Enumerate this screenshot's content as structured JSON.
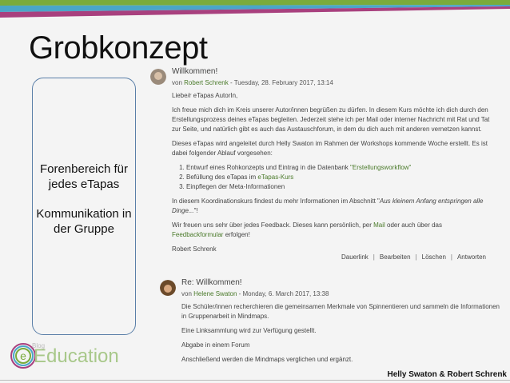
{
  "slide": {
    "title": "Grobkonzept",
    "box_lines": [
      "Forenbereich für jedes eTapas",
      "Kommunikation in der Gruppe"
    ],
    "footer": "Helly Swaton & Robert Schrenk"
  },
  "logo": {
    "small": "Blog",
    "text": "Education"
  },
  "colors": {
    "green": "#7aab3c",
    "blue": "#4aa6c8",
    "purple": "#a8407e"
  },
  "post1": {
    "title": "Willkommen!",
    "by": "von",
    "author": "Robert Schrenk",
    "date": " - Tuesday, 28. February 2017, 13:14",
    "greeting": "Liebe/r eTapas AutorIn,",
    "p1": "Ich freue mich dich im Kreis unserer Autor/innen begrüßen zu dürfen. In diesem Kurs möchte ich dich durch den Erstellungsprozess deines eTapas begleiten. Jederzeit stehe ich per Mail oder interner Nachricht mit Rat und Tat zur Seite, und natürlich gibt es auch das Austauschforum, in dem du dich auch mit anderen vernetzen kannst.",
    "p2": "Dieses eTapas wird angeleitet durch Helly Swaton im Rahmen der Workshops kommende Woche erstellt. Es ist dabei folgender Ablauf vorgesehen:",
    "steps": [
      {
        "text": "Entwurf eines Rohkonzepts und Eintrag in die Datenbank ",
        "link": "\"Erstellungsworkflow\""
      },
      {
        "text": "Befüllung des eTapas im ",
        "link": "eTapas-Kurs"
      },
      {
        "text": "Einpflegen der Meta-Informationen",
        "link": ""
      }
    ],
    "p3_pre": "In diesem Koordinationskurs findest du mehr Informationen im Abschnitt \"",
    "p3_em": "Aus kleinem Anfang entspringen alle Dinge...",
    "p3_post": "\"!",
    "p4_pre": "Wir freuen uns sehr über jedes Feedback. Dieses kann persönlich, per ",
    "p4_mail": "Mail",
    "p4_mid": " oder auch über das ",
    "p4_form": "Feedbackformular",
    "p4_post": " erfolgen!",
    "signature": "Robert Schrenk",
    "actions": [
      "Dauerlink",
      "Bearbeiten",
      "Löschen",
      "Antworten"
    ]
  },
  "post2": {
    "title": "Re: Willkommen!",
    "by": "von",
    "author": "Helene Swaton",
    "date": " - Monday, 6. March 2017, 13:38",
    "paragraphs": [
      "Die Schüler/innen recherchieren die gemeinsamen Merkmale von Spinnentieren und sammeln die Informationen in Gruppenarbeit in Mindmaps.",
      "Eine Linksammlung wird zur Verfügung gestellt.",
      "Abgabe in einem Forum",
      "Anschließend werden die Mindmaps verglichen und ergänzt."
    ]
  }
}
